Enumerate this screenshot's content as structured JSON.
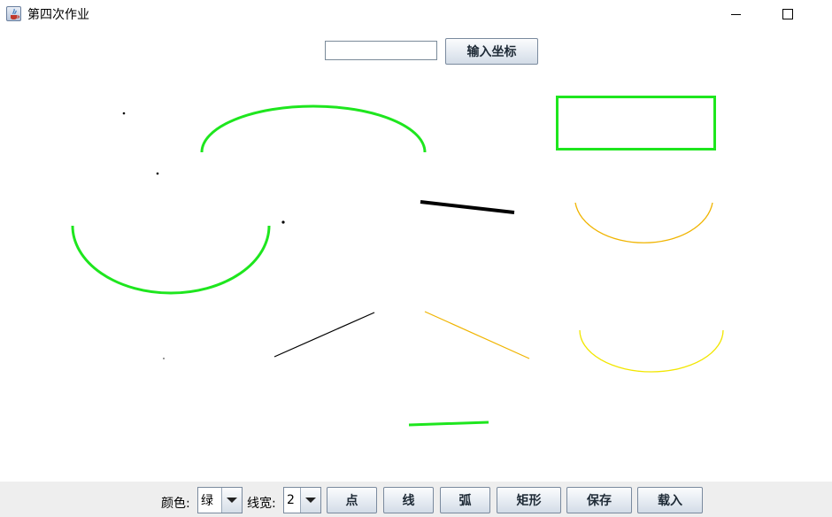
{
  "window": {
    "title": "第四次作业",
    "minimize_icon": "minimize-icon",
    "maximize_icon": "maximize-icon",
    "app_icon": "java-cup-icon"
  },
  "coordinate_panel": {
    "input_value": "",
    "input_placeholder": "",
    "button_label": "输入坐标"
  },
  "canvas": {
    "shapes": [
      {
        "type": "point",
        "color": "#000000"
      },
      {
        "type": "point",
        "color": "#000000"
      },
      {
        "type": "point",
        "color": "#000000"
      },
      {
        "type": "point",
        "color": "#000000"
      },
      {
        "type": "arc",
        "color": "#1ee61e",
        "width": 3
      },
      {
        "type": "arc",
        "color": "#1ee61e",
        "width": 3
      },
      {
        "type": "rectangle",
        "color": "#1ee61e",
        "width": 3
      },
      {
        "type": "line",
        "color": "#000000",
        "width": 4
      },
      {
        "type": "arc",
        "color": "#f0b400",
        "width": 1
      },
      {
        "type": "line",
        "color": "#000000",
        "width": 1
      },
      {
        "type": "line",
        "color": "#f0b400",
        "width": 1
      },
      {
        "type": "arc",
        "color": "#f2e600",
        "width": 1
      },
      {
        "type": "line",
        "color": "#1ee61e",
        "width": 3
      }
    ]
  },
  "toolbar": {
    "color_label": "颜色:",
    "color_value": "绿",
    "width_label": "线宽:",
    "width_value": "2",
    "buttons": [
      "点",
      "线",
      "弧",
      "矩形",
      "保存",
      "载入"
    ]
  }
}
